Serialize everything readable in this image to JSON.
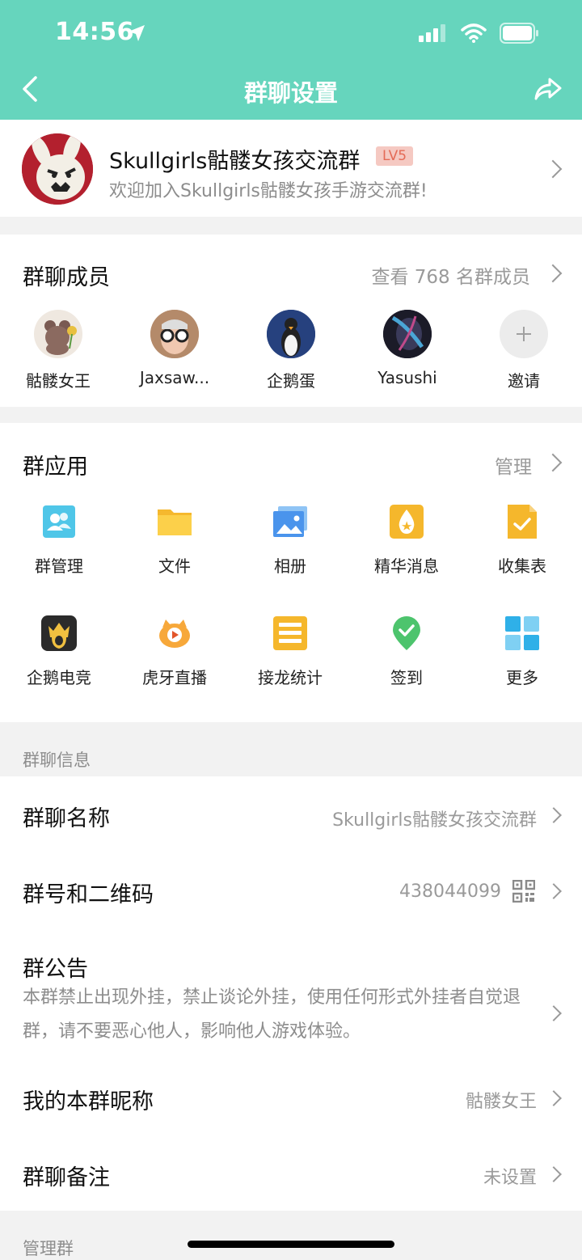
{
  "status": {
    "time": "14:56"
  },
  "nav": {
    "title": "群聊设置"
  },
  "group": {
    "name": "Skullgirls骷髅女孩交流群",
    "level": "LV5",
    "desc": "欢迎加入Skullgirls骷髅女孩手游交流群!"
  },
  "members": {
    "title": "群聊成员",
    "view_all": "查看 768 名群成员",
    "list": [
      {
        "name": "骷髅女王"
      },
      {
        "name": "Jaxsaw..."
      },
      {
        "name": "企鹅蛋"
      },
      {
        "name": "Yasushi"
      },
      {
        "name": "邀请"
      }
    ]
  },
  "apps": {
    "title": "群应用",
    "manage": "管理",
    "items": [
      {
        "label": "群管理",
        "icon": "group-manage-icon"
      },
      {
        "label": "文件",
        "icon": "folder-icon"
      },
      {
        "label": "相册",
        "icon": "album-icon"
      },
      {
        "label": "精华消息",
        "icon": "essence-icon"
      },
      {
        "label": "收集表",
        "icon": "form-icon"
      },
      {
        "label": "企鹅电竞",
        "icon": "esports-icon"
      },
      {
        "label": "虎牙直播",
        "icon": "huya-icon"
      },
      {
        "label": "接龙统计",
        "icon": "solitaire-icon"
      },
      {
        "label": "签到",
        "icon": "checkin-icon"
      },
      {
        "label": "更多",
        "icon": "more-grid-icon"
      }
    ]
  },
  "info": {
    "section": "群聊信息",
    "group_name_label": "群聊名称",
    "group_name_value": "Skullgirls骷髅女孩交流群",
    "group_id_label": "群号和二维码",
    "group_id_value": "438044099",
    "notice_label": "群公告",
    "notice_text": "本群禁止出现外挂，禁止谈论外挂，使用任何形式外挂者自觉退群，请不要恶心他人，影响他人游戏体验。",
    "nickname_label": "我的本群昵称",
    "nickname_value": "骷髅女王",
    "remark_label": "群聊备注",
    "remark_value": "未设置"
  },
  "manage": {
    "section": "管理群"
  },
  "colors": {
    "header": "#66d5bd",
    "level_bg": "#f5c9c2",
    "level_text": "#e46b57"
  }
}
